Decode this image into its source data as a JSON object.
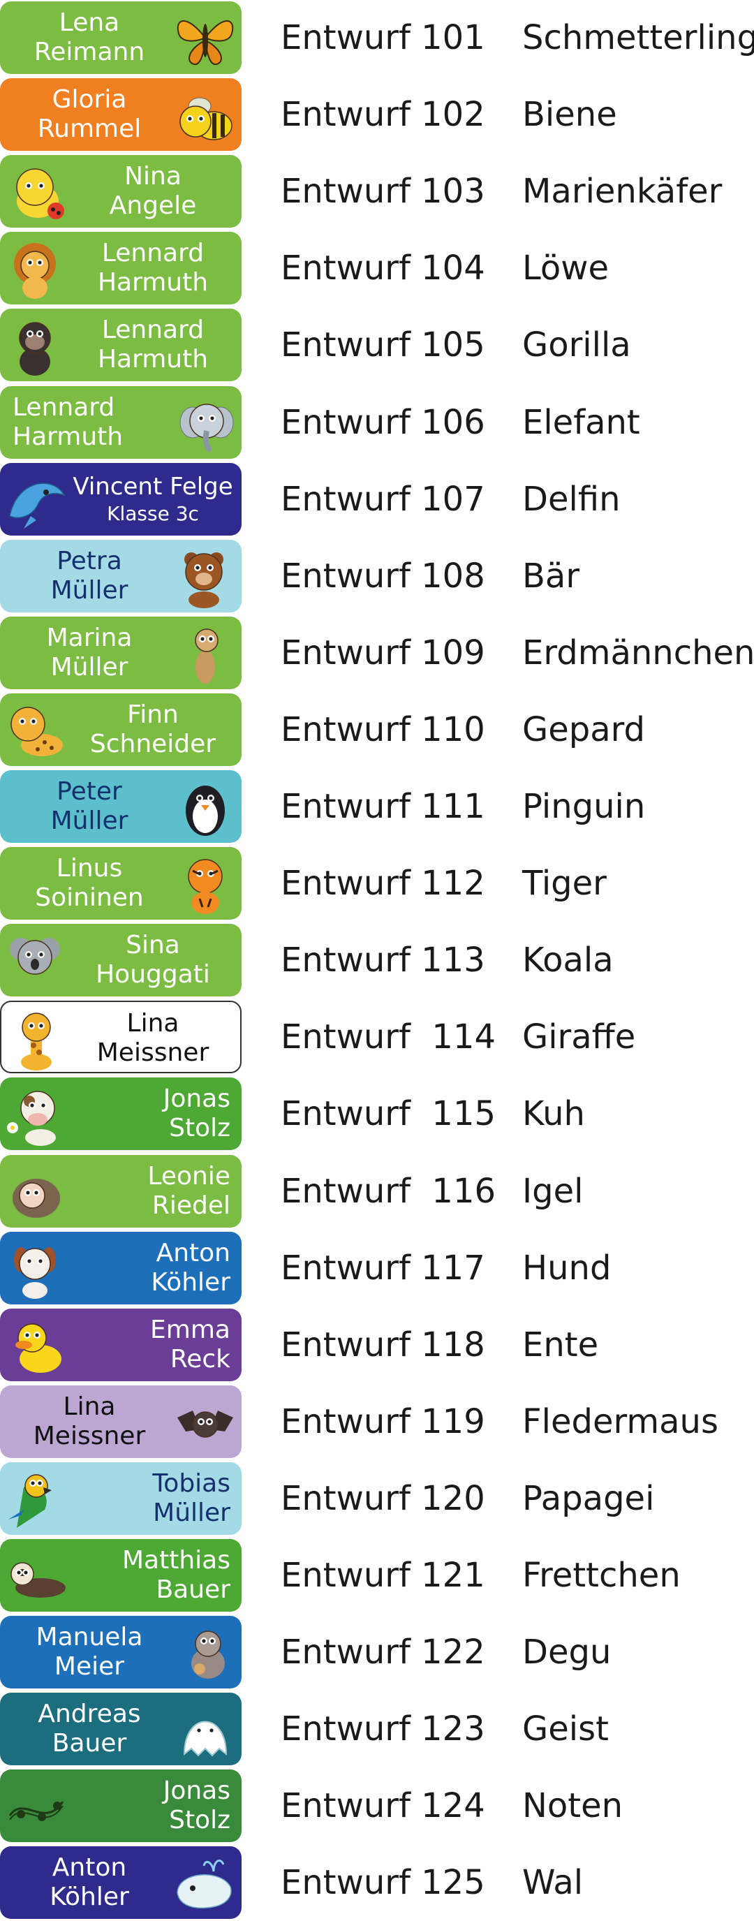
{
  "items": [
    {
      "line1": "Lena",
      "line2": "Reimann",
      "code": "Entwurf 101",
      "animal": "Schmetterling",
      "icon": "butterfly-icon",
      "bg": "#7cbc42",
      "text_color": "#ffffff",
      "text_side": "left",
      "align": "center"
    },
    {
      "line1": "Gloria",
      "line2": "Rummel",
      "code": "Entwurf 102",
      "animal": "Biene",
      "icon": "bee-icon",
      "bg": "#f07f22",
      "text_color": "#ffffff",
      "text_side": "left",
      "align": "center"
    },
    {
      "line1": "Nina",
      "line2": "Angele",
      "code": "Entwurf 103",
      "animal": "Marienkäfer",
      "icon": "ladybug-icon",
      "bg": "#7cbc42",
      "text_color": "#ffffff",
      "text_side": "right",
      "align": "center"
    },
    {
      "line1": "Lennard",
      "line2": "Harmuth",
      "code": "Entwurf 104",
      "animal": "Löwe",
      "icon": "lion-icon",
      "bg": "#7cbc42",
      "text_color": "#ffffff",
      "text_side": "right",
      "align": "center"
    },
    {
      "line1": "Lennard",
      "line2": "Harmuth",
      "code": "Entwurf 105",
      "animal": "Gorilla",
      "icon": "gorilla-icon",
      "bg": "#7cbc42",
      "text_color": "#ffffff",
      "text_side": "right",
      "align": "center"
    },
    {
      "line1": "Lennard",
      "line2": "Harmuth",
      "code": "Entwurf 106",
      "animal": "Elefant",
      "icon": "elephant-icon",
      "bg": "#7cbc42",
      "text_color": "#ffffff",
      "text_side": "left",
      "align": "left"
    },
    {
      "line1": "Vincent Felge",
      "line2": "Klasse 3c",
      "code": "Entwurf 107",
      "animal": "Delfin",
      "icon": "dolphin-icon",
      "bg": "#2f2b8c",
      "text_color": "#ffffff",
      "text_side": "right",
      "align": "center",
      "small": true
    },
    {
      "line1": "Petra",
      "line2": "Müller",
      "code": "Entwurf 108",
      "animal": "Bär",
      "icon": "bear-icon",
      "bg": "#a4d9e6",
      "text_color": "#16306e",
      "text_side": "left",
      "align": "center"
    },
    {
      "line1": "Marina",
      "line2": "Müller",
      "code": "Entwurf 109",
      "animal": "Erdmännchen",
      "icon": "meerkat-icon",
      "bg": "#7cbc42",
      "text_color": "#ffffff",
      "text_side": "left",
      "align": "center"
    },
    {
      "line1": "Finn",
      "line2": "Schneider",
      "code": "Entwurf 110",
      "animal": "Gepard",
      "icon": "cheetah-icon",
      "bg": "#7cbc42",
      "text_color": "#ffffff",
      "text_side": "right",
      "align": "center"
    },
    {
      "line1": "Peter",
      "line2": "Müller",
      "code": "Entwurf 111",
      "animal": "Pinguin",
      "icon": "penguin-icon",
      "bg": "#5cc0cc",
      "text_color": "#16306e",
      "text_side": "left",
      "align": "center"
    },
    {
      "line1": "Linus",
      "line2": "Soininen",
      "code": "Entwurf 112",
      "animal": "Tiger",
      "icon": "tiger-icon",
      "bg": "#7cbc42",
      "text_color": "#ffffff",
      "text_side": "left",
      "align": "center"
    },
    {
      "line1": "Sina",
      "line2": "Houggati",
      "code": "Entwurf 113",
      "animal": "Koala",
      "icon": "koala-icon",
      "bg": "#7cbc42",
      "text_color": "#ffffff",
      "text_side": "right",
      "align": "center"
    },
    {
      "line1": "Lina",
      "line2": "Meissner",
      "code": "Entwurf  114",
      "animal": "Giraffe",
      "icon": "giraffe-icon",
      "bg": "#ffffff",
      "text_color": "#111111",
      "text_side": "right",
      "align": "center",
      "white": true
    },
    {
      "line1": "Jonas",
      "line2": "Stolz",
      "code": "Entwurf  115",
      "animal": "Kuh",
      "icon": "cow-icon",
      "bg": "#4ea834",
      "text_color": "#ffffff",
      "text_side": "right",
      "align": "right"
    },
    {
      "line1": "Leonie",
      "line2": "Riedel",
      "code": "Entwurf  116",
      "animal": "Igel",
      "icon": "hedgehog-icon",
      "bg": "#7cbc42",
      "text_color": "#ffffff",
      "text_side": "right",
      "align": "right"
    },
    {
      "line1": "Anton",
      "line2": "Köhler",
      "code": "Entwurf 117",
      "animal": "Hund",
      "icon": "dog-icon",
      "bg": "#1e6fba",
      "text_color": "#ffffff",
      "text_side": "right",
      "align": "right"
    },
    {
      "line1": "Emma",
      "line2": "Reck",
      "code": "Entwurf 118",
      "animal": "Ente",
      "icon": "duck-icon",
      "bg": "#6a3d96",
      "text_color": "#ffffff",
      "text_side": "right",
      "align": "right"
    },
    {
      "line1": "Lina",
      "line2": "Meissner",
      "code": "Entwurf 119",
      "animal": "Fledermaus",
      "icon": "bat-icon",
      "bg": "#bca6d2",
      "text_color": "#111111",
      "text_side": "left",
      "align": "center"
    },
    {
      "line1": "Tobias",
      "line2": "Müller",
      "code": "Entwurf 120",
      "animal": "Papagei",
      "icon": "parrot-icon",
      "bg": "#a4d9e6",
      "text_color": "#16306e",
      "text_side": "right",
      "align": "right"
    },
    {
      "line1": "Matthias",
      "line2": "Bauer",
      "code": "Entwurf 121",
      "animal": "Frettchen",
      "icon": "ferret-icon",
      "bg": "#4ea834",
      "text_color": "#ffffff",
      "text_side": "right",
      "align": "right"
    },
    {
      "line1": "Manuela",
      "line2": "Meier",
      "code": "Entwurf 122",
      "animal": "Degu",
      "icon": "degu-icon",
      "bg": "#1e6fba",
      "text_color": "#ffffff",
      "text_side": "left",
      "align": "center"
    },
    {
      "line1": "Andreas",
      "line2": "Bauer",
      "code": "Entwurf 123",
      "animal": "Geist",
      "icon": "ghost-icon",
      "bg": "#1c6e7e",
      "text_color": "#ffffff",
      "text_side": "left",
      "align": "center"
    },
    {
      "line1": "Jonas",
      "line2": "Stolz",
      "code": "Entwurf 124",
      "animal": "Noten",
      "icon": "music-notes-icon",
      "bg": "#3a8a3c",
      "text_color": "#ffffff",
      "text_side": "right",
      "align": "right"
    },
    {
      "line1": "Anton",
      "line2": "Köhler",
      "code": "Entwurf 125",
      "animal": "Wal",
      "icon": "whale-icon",
      "bg": "#2f2b8c",
      "text_color": "#ffffff",
      "text_side": "left",
      "align": "center"
    }
  ]
}
